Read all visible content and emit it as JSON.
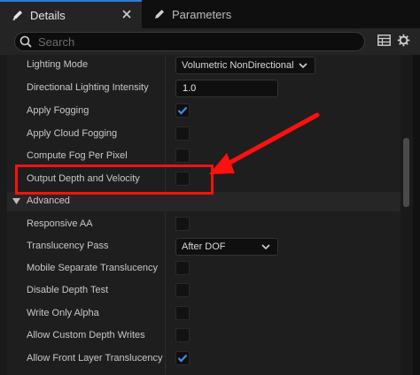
{
  "tabs": [
    {
      "label": "Details",
      "icon": "pencil-icon",
      "active": true
    },
    {
      "label": "Parameters",
      "icon": "pencil-icon",
      "active": false
    }
  ],
  "search": {
    "placeholder": "Search",
    "value": ""
  },
  "toolbar": {
    "icons": [
      "table-view-icon",
      "gear-icon"
    ]
  },
  "rows_top": [
    {
      "label": "Lighting Mode",
      "type": "dropdown",
      "value": "Volumetric NonDirectional"
    },
    {
      "label": "Directional Lighting Intensity",
      "type": "number",
      "value": "1.0"
    },
    {
      "label": "Apply Fogging",
      "type": "checkbox",
      "checked": true
    },
    {
      "label": "Apply Cloud Fogging",
      "type": "checkbox",
      "checked": false
    },
    {
      "label": "Compute Fog Per Pixel",
      "type": "checkbox",
      "checked": false
    },
    {
      "label": "Output Depth and Velocity",
      "type": "checkbox",
      "checked": false
    }
  ],
  "section": {
    "label": "Advanced",
    "expanded": true
  },
  "rows_advanced": [
    {
      "label": "Responsive AA",
      "type": "checkbox",
      "checked": false
    },
    {
      "label": "Translucency Pass",
      "type": "dropdown",
      "value": "After DOF"
    },
    {
      "label": "Mobile Separate Translucency",
      "type": "checkbox",
      "checked": false
    },
    {
      "label": "Disable Depth Test",
      "type": "checkbox",
      "checked": false
    },
    {
      "label": "Write Only Alpha",
      "type": "checkbox",
      "checked": false
    },
    {
      "label": "Allow Custom Depth Writes",
      "type": "checkbox",
      "checked": false
    },
    {
      "label": "Allow Front Layer Translucency",
      "type": "checkbox",
      "checked": true
    }
  ],
  "annotation": {
    "color": "#ff1010",
    "target": "Output Depth and Velocity"
  }
}
